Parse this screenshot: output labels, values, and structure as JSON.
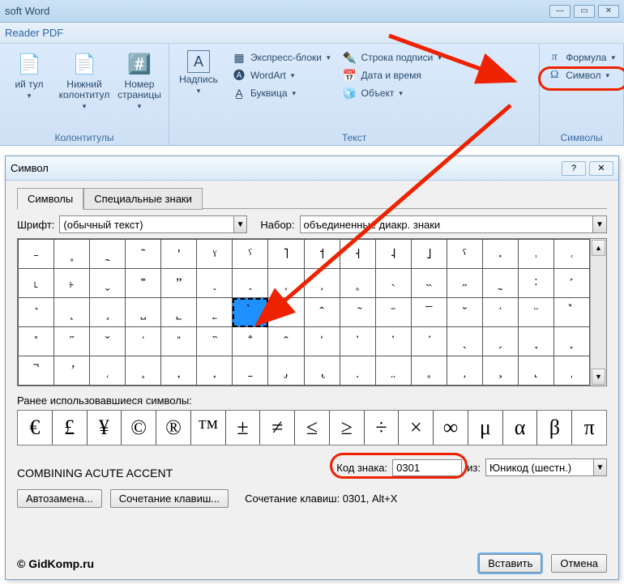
{
  "titlebar": {
    "app": "soft Word"
  },
  "quickbar": {
    "text": "Reader PDF"
  },
  "ribbon": {
    "group1": {
      "label": "Колонтитулы",
      "btn1": "ий\nтул",
      "btn2": "Нижний\nколонтитул",
      "btn3": "Номер\nстраницы"
    },
    "group2": {
      "label": "Текст",
      "nadpis": "Надпись",
      "express": "Экспресс-блоки",
      "wordart": "WordArt",
      "bukvitsa": "Буквица",
      "signline": "Строка подписи",
      "datetime": "Дата и время",
      "object": "Объект"
    },
    "group3": {
      "label": "Символы",
      "formula": "Формула",
      "symbol": "Символ"
    }
  },
  "dialog": {
    "title": "Символ",
    "tabs": {
      "symbols": "Символы",
      "special": "Специальные знаки"
    },
    "font_label": "Шрифт:",
    "font_value": "(обычный текст)",
    "set_label": "Набор:",
    "set_value": "объединенные диакр. знаки",
    "recent_label": "Ранее использовавшиеся символы:",
    "recent": [
      "€",
      "£",
      "¥",
      "©",
      "®",
      "™",
      "±",
      "≠",
      "≤",
      "≥",
      "÷",
      "×",
      "∞",
      "μ",
      "α",
      "β",
      "π"
    ],
    "grid_row1": [
      "˗",
      "˳",
      "˷",
      "˜",
      "'",
      "ˠ",
      "ˤ",
      "˥",
      "˦",
      "˧",
      "˨",
      "˩",
      "ˁ",
      "˖",
      "˒",
      "˓"
    ],
    "grid_row2": [
      "˪",
      "˫",
      "ˬ",
      "˭",
      "ˮ",
      "˯",
      "˰",
      "˱",
      "˲",
      "˳",
      "˴",
      "˵",
      "˶",
      "˷",
      "˸",
      "˹"
    ],
    "grid_row3": [
      "˺",
      "˻",
      "˼",
      "˽",
      "˾",
      "˿",
      "̀",
      "́",
      "̂",
      "̃",
      "̄",
      "̅",
      "̆",
      "̇",
      "̈",
      "̉"
    ],
    "grid_row4": [
      "̊",
      "̋",
      "̌",
      "̍",
      "̎",
      "̏",
      "̐",
      "̑",
      "̒",
      "̓",
      "̔",
      "̕",
      "̖",
      "̗",
      "̘",
      "̙"
    ],
    "grid_row5": [
      "̚",
      "̛",
      "̜",
      "̝",
      "̞",
      "̟",
      "̠",
      "̡",
      "̢",
      "̣",
      "̤",
      "̥",
      "̦",
      "̧",
      "̨",
      "̩"
    ],
    "charname": "COMBINING ACUTE ACCENT",
    "code_label": "Код знака:",
    "code_value": "0301",
    "from_label": "из:",
    "from_value": "Юникод (шестн.)",
    "autocorrect": "Автозамена...",
    "shortcut": "Сочетание клавиш...",
    "shortcut_info": "Сочетание клавиш: 0301, Alt+X",
    "insert": "Вставить",
    "cancel": "Отмена",
    "credit": "© GidKomp.ru"
  }
}
